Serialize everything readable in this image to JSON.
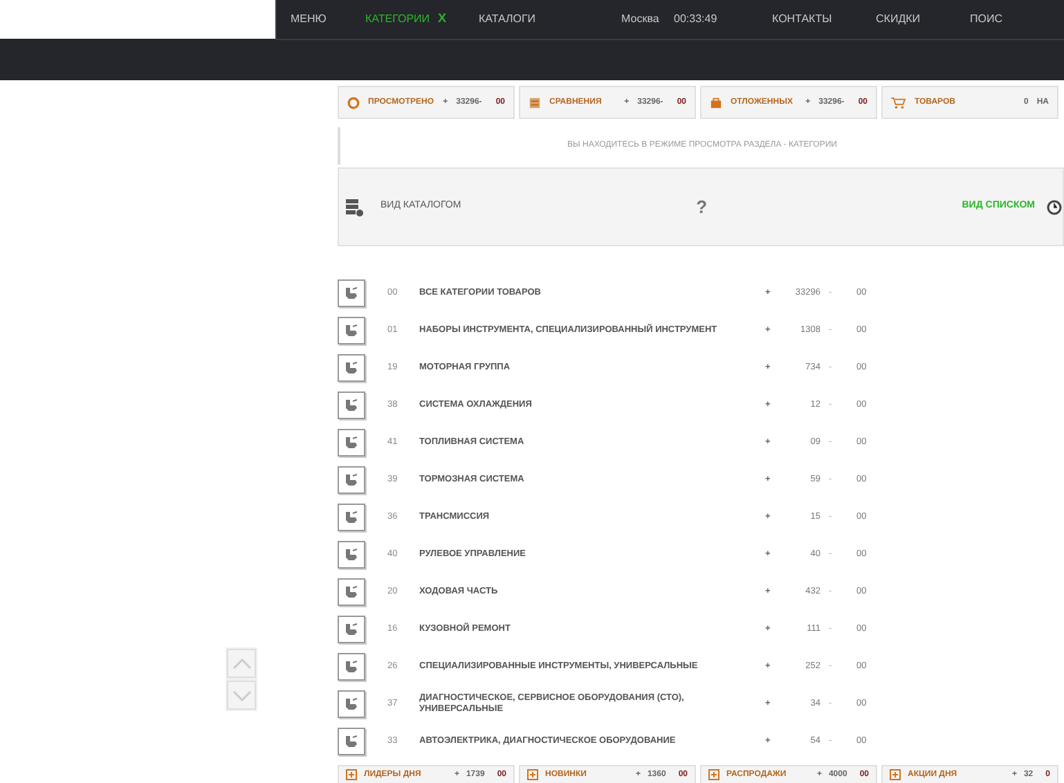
{
  "nav": [
    {
      "label": "МЕНЮ",
      "selected": false
    },
    {
      "label": "КАТЕГОРИИ",
      "selected": true,
      "close": "Х"
    },
    {
      "label": "КАТАЛОГИ",
      "selected": false
    }
  ],
  "location": {
    "city": "Москва",
    "time": "00:33:49"
  },
  "nav_right": [
    "КОНТАКТЫ",
    "СКИДКИ",
    "ПОИС"
  ],
  "counters": [
    {
      "label": "ПРОСМОТРЕНО",
      "plus": "+",
      "count": "33296-",
      "tail": "00"
    },
    {
      "label": "СРАВНЕНИЯ",
      "plus": "+",
      "count": "33296-",
      "tail": "00"
    },
    {
      "label": "ОТЛОЖЕННЫХ",
      "plus": "+",
      "count": "33296-",
      "tail": "00"
    },
    {
      "label": "ТОВАРОВ",
      "plus": "0",
      "count": "НА"
    }
  ],
  "notice": "ВЫ НАХОДИТЕСЬ В РЕЖИМЕ ПРОСМОТРА РАЗДЕЛА - КАТЕГОРИИ",
  "view_modes": [
    {
      "label": "ВИД КАТАЛОГОМ",
      "selected": false
    },
    {
      "label": "ВИД СПИСКОМ",
      "selected": true
    }
  ],
  "help": "?",
  "rows": [
    {
      "code": "00",
      "name": "ВСЕ КАТЕГОРИИ ТОВАРОВ",
      "plus": "+",
      "count": "33296",
      "dash": "-",
      "tail": "00"
    },
    {
      "code": "01",
      "name": "НАБОРЫ ИНСТРУМЕНТА, СПЕЦИАЛИЗИРОВАННЫЙ ИНСТРУМЕНТ",
      "plus": "+",
      "count": "1308",
      "dash": "-",
      "tail": "00"
    },
    {
      "code": "19",
      "name": "МОТОРНАЯ ГРУППА",
      "plus": "+",
      "count": "734",
      "dash": "-",
      "tail": "00"
    },
    {
      "code": "38",
      "name": "СИСТЕМА ОХЛАЖДЕНИЯ",
      "plus": "+",
      "count": "12",
      "dash": "-",
      "tail": "00"
    },
    {
      "code": "41",
      "name": "ТОПЛИВНАЯ СИСТЕМА",
      "plus": "+",
      "count": "09",
      "dash": "-",
      "tail": "00"
    },
    {
      "code": "39",
      "name": "ТОРМОЗНАЯ СИСТЕМА",
      "plus": "+",
      "count": "59",
      "dash": "-",
      "tail": "00"
    },
    {
      "code": "36",
      "name": "ТРАНСМИССИЯ",
      "plus": "+",
      "count": "15",
      "dash": "-",
      "tail": "00"
    },
    {
      "code": "40",
      "name": "РУЛЕВОЕ УПРАВЛЕНИЕ",
      "plus": "+",
      "count": "40",
      "dash": "-",
      "tail": "00"
    },
    {
      "code": "20",
      "name": "ХОДОВАЯ ЧАСТЬ",
      "plus": "+",
      "count": "432",
      "dash": "-",
      "tail": "00"
    },
    {
      "code": "16",
      "name": "КУЗОВНОЙ РЕМОНТ",
      "plus": "+",
      "count": "111",
      "dash": "-",
      "tail": "00"
    },
    {
      "code": "26",
      "name": "СПЕЦИАЛИЗИРОВАННЫЕ ИНСТРУМЕНТЫ, УНИВЕРСАЛЬНЫЕ",
      "plus": "+",
      "count": "252",
      "dash": "-",
      "tail": "00"
    },
    {
      "code": "37",
      "name": "ДИАГНОСТИЧЕСКОЕ, СЕРВИСНОЕ ОБОРУДОВАНИЯ (СТО), УНИВЕРСАЛЬНЫЕ",
      "plus": "+",
      "count": "34",
      "dash": "-",
      "tail": "00"
    },
    {
      "code": "33",
      "name": "АВТОЭЛЕКТРИКА, ДИАГНОСТИЧЕСКОЕ ОБОРУДОВАНИЕ",
      "plus": "+",
      "count": "54",
      "dash": "-",
      "tail": "00"
    }
  ],
  "bottom_counters": [
    {
      "label": "ЛИДЕРЫ ДНЯ",
      "plus": "+",
      "count": "1739",
      "tail": "00"
    },
    {
      "label": "НОВИНКИ",
      "plus": "+",
      "count": "1360",
      "tail": "00"
    },
    {
      "label": "РАСПРОДАЖИ",
      "plus": "+",
      "count": "4000",
      "tail": "00"
    },
    {
      "label": "АКЦИИ ДНЯ",
      "plus": "+",
      "count": "32",
      "tail": "0"
    }
  ]
}
